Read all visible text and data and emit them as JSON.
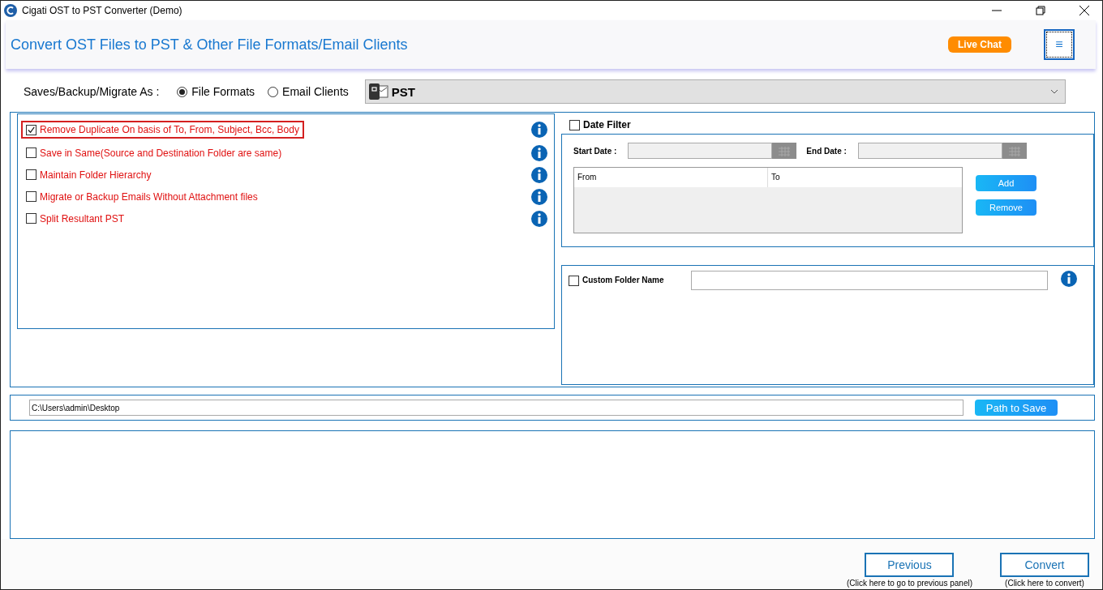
{
  "window": {
    "title": "Cigati OST to PST Converter (Demo)"
  },
  "header": {
    "title": "Convert OST Files to PST & Other File Formats/Email Clients",
    "live_chat": "Live Chat",
    "menu_glyph": "≡"
  },
  "save_as": {
    "label": "Saves/Backup/Migrate As :",
    "options": [
      {
        "label": "File Formats",
        "selected": true
      },
      {
        "label": "Email Clients",
        "selected": false
      }
    ],
    "format": "PST"
  },
  "options": [
    {
      "label": "Remove Duplicate On basis of To, From, Subject, Bcc, Body",
      "checked": true,
      "highlighted": true
    },
    {
      "label": "Save in Same(Source and Destination Folder are same)",
      "checked": false,
      "highlighted": false
    },
    {
      "label": "Maintain Folder Hierarchy",
      "checked": false,
      "highlighted": false
    },
    {
      "label": "Migrate or Backup Emails Without Attachment files",
      "checked": false,
      "highlighted": false
    },
    {
      "label": "Split Resultant PST",
      "checked": false,
      "highlighted": false
    }
  ],
  "date_filter": {
    "label": "Date Filter",
    "checked": false,
    "start_label": "Start Date :",
    "end_label": "End Date :",
    "columns": [
      "From",
      "To"
    ],
    "buttons": [
      "Add",
      "Remove"
    ]
  },
  "custom_folder": {
    "label": "Custom Folder Name",
    "checked": false
  },
  "path": {
    "value": "C:\\Users\\admin\\Desktop",
    "button": "Path to Save"
  },
  "footer": [
    {
      "button": "Previous",
      "hint": "(Click here to go to previous panel)"
    },
    {
      "button": "Convert",
      "hint": "(Click here to convert)"
    }
  ]
}
